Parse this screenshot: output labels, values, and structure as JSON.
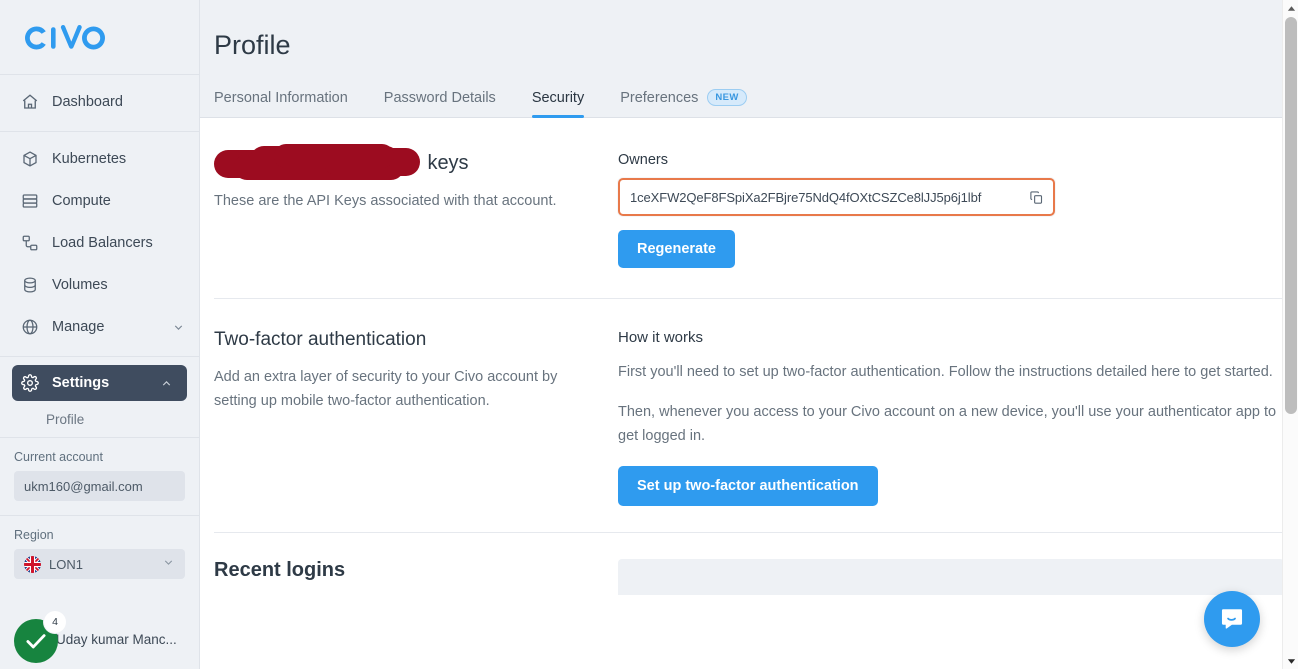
{
  "brand": {
    "logo_text": "CIVO",
    "accent": "#2f9bef",
    "sidebar_active_bg": "#3f4c5f"
  },
  "sidebar": {
    "items": [
      {
        "label": "Dashboard",
        "icon": "home-icon"
      },
      {
        "label": "Kubernetes",
        "icon": "cube-icon"
      },
      {
        "label": "Compute",
        "icon": "server-icon"
      },
      {
        "label": "Load Balancers",
        "icon": "load-balancer-icon"
      },
      {
        "label": "Volumes",
        "icon": "database-icon"
      },
      {
        "label": "Manage",
        "icon": "globe-icon",
        "chevron": "chevron-down-icon"
      }
    ],
    "settings": {
      "label": "Settings",
      "icon": "gear-icon",
      "chevron": "chevron-up-icon"
    },
    "sub_items": [
      {
        "label": "Profile"
      }
    ],
    "account": {
      "label": "Current account",
      "value": "ukm160@gmail.com"
    },
    "region": {
      "label": "Region",
      "value": "LON1",
      "flag": "uk-flag-icon",
      "chevron": "chevron-down-icon"
    },
    "user": {
      "name": "Uday kumar Manc...",
      "badge_count": "4",
      "check_icon": "check-icon"
    }
  },
  "header": {
    "title": "Profile",
    "tabs": [
      {
        "label": "Personal Information",
        "active": false
      },
      {
        "label": "Password Details",
        "active": false
      },
      {
        "label": "Security",
        "active": true
      },
      {
        "label": "Preferences",
        "active": false,
        "badge": "NEW"
      }
    ]
  },
  "api_keys": {
    "heading_suffix": "keys",
    "heading_redacted": true,
    "description": "These are the API Keys associated with that account.",
    "owners_label": "Owners",
    "key_value": "1ceXFW2QeF8FSpiXa2FBjre75NdQ4fOXtCSZCe8lJJ5p6j1lbf",
    "copy_icon": "copy-icon",
    "regenerate_label": "Regenerate"
  },
  "two_factor": {
    "heading": "Two-factor authentication",
    "description": "Add an extra layer of security to your Civo account by setting up mobile two-factor authentication.",
    "how_heading": "How it works",
    "paragraph_1": "First you'll need to set up two-factor authentication. Follow the instructions detailed here to get started.",
    "paragraph_2": "Then, whenever you access to your Civo account on a new device, you'll use your authenticator app to get logged in.",
    "setup_button": "Set up two-factor authentication"
  },
  "recent_logins": {
    "heading": "Recent logins"
  },
  "chat": {
    "icon": "chat-bubble-icon"
  },
  "scrollbar": {
    "up_icon": "caret-up-icon",
    "down_icon": "caret-down-icon"
  }
}
